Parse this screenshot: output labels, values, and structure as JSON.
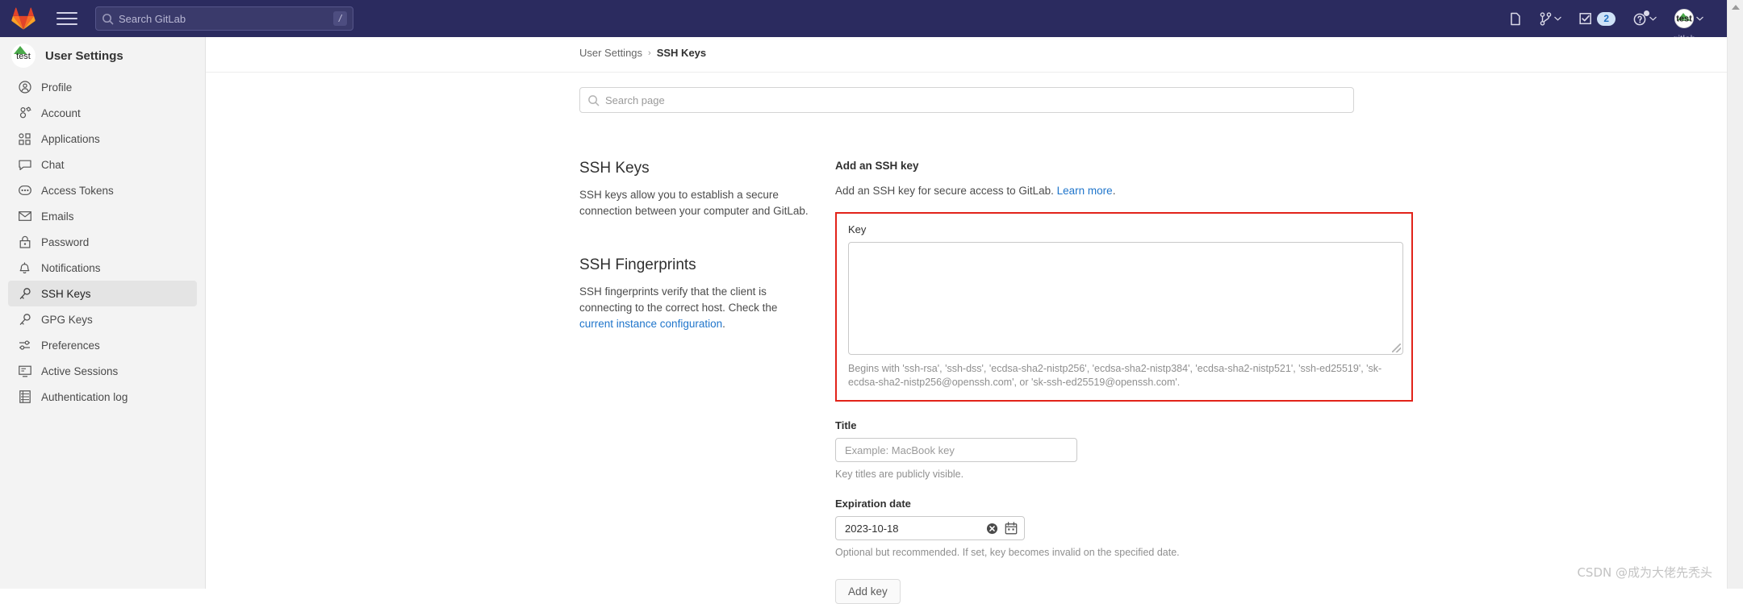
{
  "navbar": {
    "logo_icon": "gitlab-logo-icon",
    "hamburger_icon": "hamburger-menu-icon",
    "search": {
      "placeholder": "Search GitLab",
      "shortcut": "/",
      "icon": "search-icon"
    },
    "right_items": [
      {
        "name": "new-item",
        "icon": "new-document-icon",
        "label": "",
        "chevron": false
      },
      {
        "name": "merge-requests",
        "icon": "merge-request-icon",
        "label": "",
        "chevron": true
      },
      {
        "name": "todos",
        "icon": "todo-checkbox-icon",
        "badge": "2",
        "chevron": false
      },
      {
        "name": "help",
        "icon": "help-question-icon",
        "label": "",
        "chevron": true
      }
    ],
    "avatar": {
      "alt_text": "test",
      "sub_text": "gitlab",
      "chevron": true
    }
  },
  "sidebar": {
    "header": {
      "avatar_alt": "test",
      "title": "User Settings"
    },
    "items": [
      {
        "label": "Profile",
        "icon": "user-circle-icon",
        "active": false
      },
      {
        "label": "Account",
        "icon": "account-gear-icon",
        "active": false
      },
      {
        "label": "Applications",
        "icon": "applications-grid-icon",
        "active": false
      },
      {
        "label": "Chat",
        "icon": "chat-bubble-icon",
        "active": false
      },
      {
        "label": "Access Tokens",
        "icon": "token-ellipsis-icon",
        "active": false
      },
      {
        "label": "Emails",
        "icon": "envelope-icon",
        "active": false
      },
      {
        "label": "Password",
        "icon": "lock-icon",
        "active": false
      },
      {
        "label": "Notifications",
        "icon": "bell-icon",
        "active": false
      },
      {
        "label": "SSH Keys",
        "icon": "key-icon",
        "active": true
      },
      {
        "label": "GPG Keys",
        "icon": "key-icon",
        "active": false
      },
      {
        "label": "Preferences",
        "icon": "sliders-icon",
        "active": false
      },
      {
        "label": "Active Sessions",
        "icon": "monitor-icon",
        "active": false
      },
      {
        "label": "Authentication log",
        "icon": "log-list-icon",
        "active": false
      }
    ]
  },
  "main": {
    "breadcrumb": {
      "parent": "User Settings",
      "separator": "›",
      "current": "SSH Keys"
    },
    "page_search": {
      "placeholder": "Search page",
      "icon": "search-icon"
    },
    "doc": {
      "ssh_keys_heading": "SSH Keys",
      "ssh_keys_body": "SSH keys allow you to establish a secure connection between your computer and GitLab.",
      "fingerprints_heading": "SSH Fingerprints",
      "fingerprints_body_pre": "SSH fingerprints verify that the client is connecting to the correct host. Check the ",
      "fingerprints_link": "current instance configuration",
      "fingerprints_body_post": "."
    },
    "form": {
      "heading": "Add an SSH key",
      "subheading_pre": "Add an SSH key for secure access to GitLab. ",
      "subheading_link": "Learn more",
      "subheading_post": ".",
      "key_label": "Key",
      "key_value": "",
      "key_help": "Begins with 'ssh-rsa', 'ssh-dss', 'ecdsa-sha2-nistp256', 'ecdsa-sha2-nistp384', 'ecdsa-sha2-nistp521', 'ssh-ed25519', 'sk-ecdsa-sha2-nistp256@openssh.com', or 'sk-ssh-ed25519@openssh.com'.",
      "title_label": "Title",
      "title_placeholder": "Example: MacBook key",
      "title_hint": "Key titles are publicly visible.",
      "expiration_label": "Expiration date",
      "expiration_value": "2023-10-18",
      "expiration_hint": "Optional but recommended. If set, key becomes invalid on the specified date.",
      "clear_icon": "clear-circle-x-icon",
      "calendar_icon": "calendar-icon",
      "submit_label": "Add key",
      "highlight_color": "#e2231a"
    }
  },
  "scrollbar": {
    "up_arrow_icon": "scroll-up-arrow-icon"
  },
  "watermark": "CSDN @成为大佬先秃头"
}
